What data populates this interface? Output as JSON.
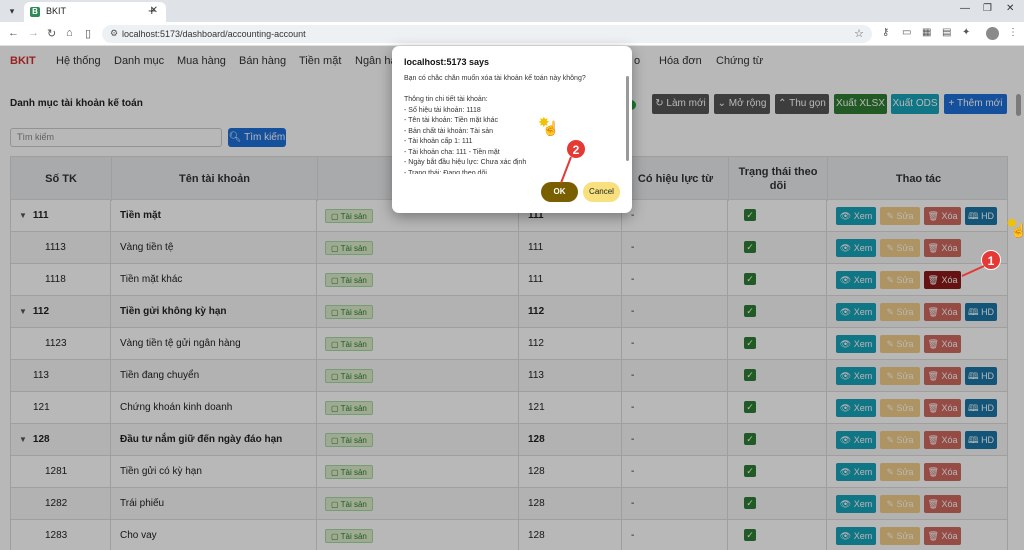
{
  "browser": {
    "tab_title": "BKIT",
    "tab_favicon": "B",
    "url": "localhost:5173/dashboard/accounting-account"
  },
  "app": {
    "brand": "BKIT",
    "menu": [
      "Hệ thống",
      "Danh mục",
      "Mua hàng",
      "Bán hàng",
      "Tiền mặt",
      "Ngân hà",
      "o",
      "Hóa đơn",
      "Chứng từ"
    ],
    "page_title": "Danh mục tài khoản kế toán",
    "toolbar": {
      "refresh": "Làm mới",
      "expand": "Mở rộng",
      "collapse": "Thu gọn",
      "export_xlsx": "Xuất XLSX",
      "export_ods": "Xuất ODS",
      "add_new": "+  Thêm mới"
    },
    "search": {
      "placeholder": "Tìm kiếm",
      "button": "Tìm kiếm"
    }
  },
  "table": {
    "headers": [
      "Số TK",
      "Tên tài khoản",
      "Bản",
      "",
      "Có hiệu lực từ",
      "Trạng thái theo dõi",
      "Thao tác"
    ],
    "actions": {
      "view": "Xem",
      "edit": "Sửa",
      "delete": "Xóa",
      "hd": "HD"
    },
    "rows": [
      {
        "code": "111",
        "name": "Tiền mặt",
        "badge": "Tài sản",
        "parent": "111",
        "from": "-",
        "group": true
      },
      {
        "code": "1113",
        "name": "Vàng tiền tệ",
        "badge": "Tài sản",
        "parent": "111",
        "from": "-",
        "group": false
      },
      {
        "code": "1118",
        "name": "Tiền mặt khác",
        "badge": "Tài sản",
        "parent": "111",
        "from": "-",
        "group": false
      },
      {
        "code": "112",
        "name": "Tiền gửi không kỳ hạn",
        "badge": "Tài sản",
        "parent": "112",
        "from": "-",
        "group": true
      },
      {
        "code": "1123",
        "name": "Vàng tiền tệ gửi ngân hàng",
        "badge": "Tài sản",
        "parent": "112",
        "from": "-",
        "group": false
      },
      {
        "code": "113",
        "name": "Tiền đang chuyển",
        "badge": "Tài sản",
        "parent": "113",
        "from": "-",
        "group": false
      },
      {
        "code": "121",
        "name": "Chứng khoán kinh doanh",
        "badge": "Tài sản",
        "parent": "121",
        "from": "-",
        "group": false
      },
      {
        "code": "128",
        "name": "Đầu tư nắm giữ đến ngày đáo hạn",
        "badge": "Tài sản",
        "parent": "128",
        "from": "-",
        "group": true
      },
      {
        "code": "1281",
        "name": "Tiền gửi có kỳ hạn",
        "badge": "Tài sản",
        "parent": "128",
        "from": "-",
        "group": false
      },
      {
        "code": "1282",
        "name": "Trái phiếu",
        "badge": "Tài sản",
        "parent": "128",
        "from": "-",
        "group": false
      },
      {
        "code": "1283",
        "name": "Cho vay",
        "badge": "Tài sản",
        "parent": "128",
        "from": "-",
        "group": false
      }
    ]
  },
  "dialog": {
    "title": "localhost:5173 says",
    "lines": [
      "Bạn có chắc chắn muốn xóa tài khoản kế toán này không?",
      "",
      "Thông tin chi tiết tài khoản:",
      "- Số hiệu tài khoản: 1118",
      "- Tên tài khoản: Tiền mặt khác",
      "- Bản chất tài khoản: Tài sản",
      "- Tài khoản cấp 1: 111",
      "- Tài khoản cha: 111 - Tiền mặt",
      "- Ngày bắt đầu hiệu lực: Chưa xác định",
      "- Trạng thái: Đang theo dõi"
    ],
    "ok": "OK",
    "cancel": "Cancel"
  },
  "annotations": {
    "marker1": "1",
    "marker2": "2"
  }
}
